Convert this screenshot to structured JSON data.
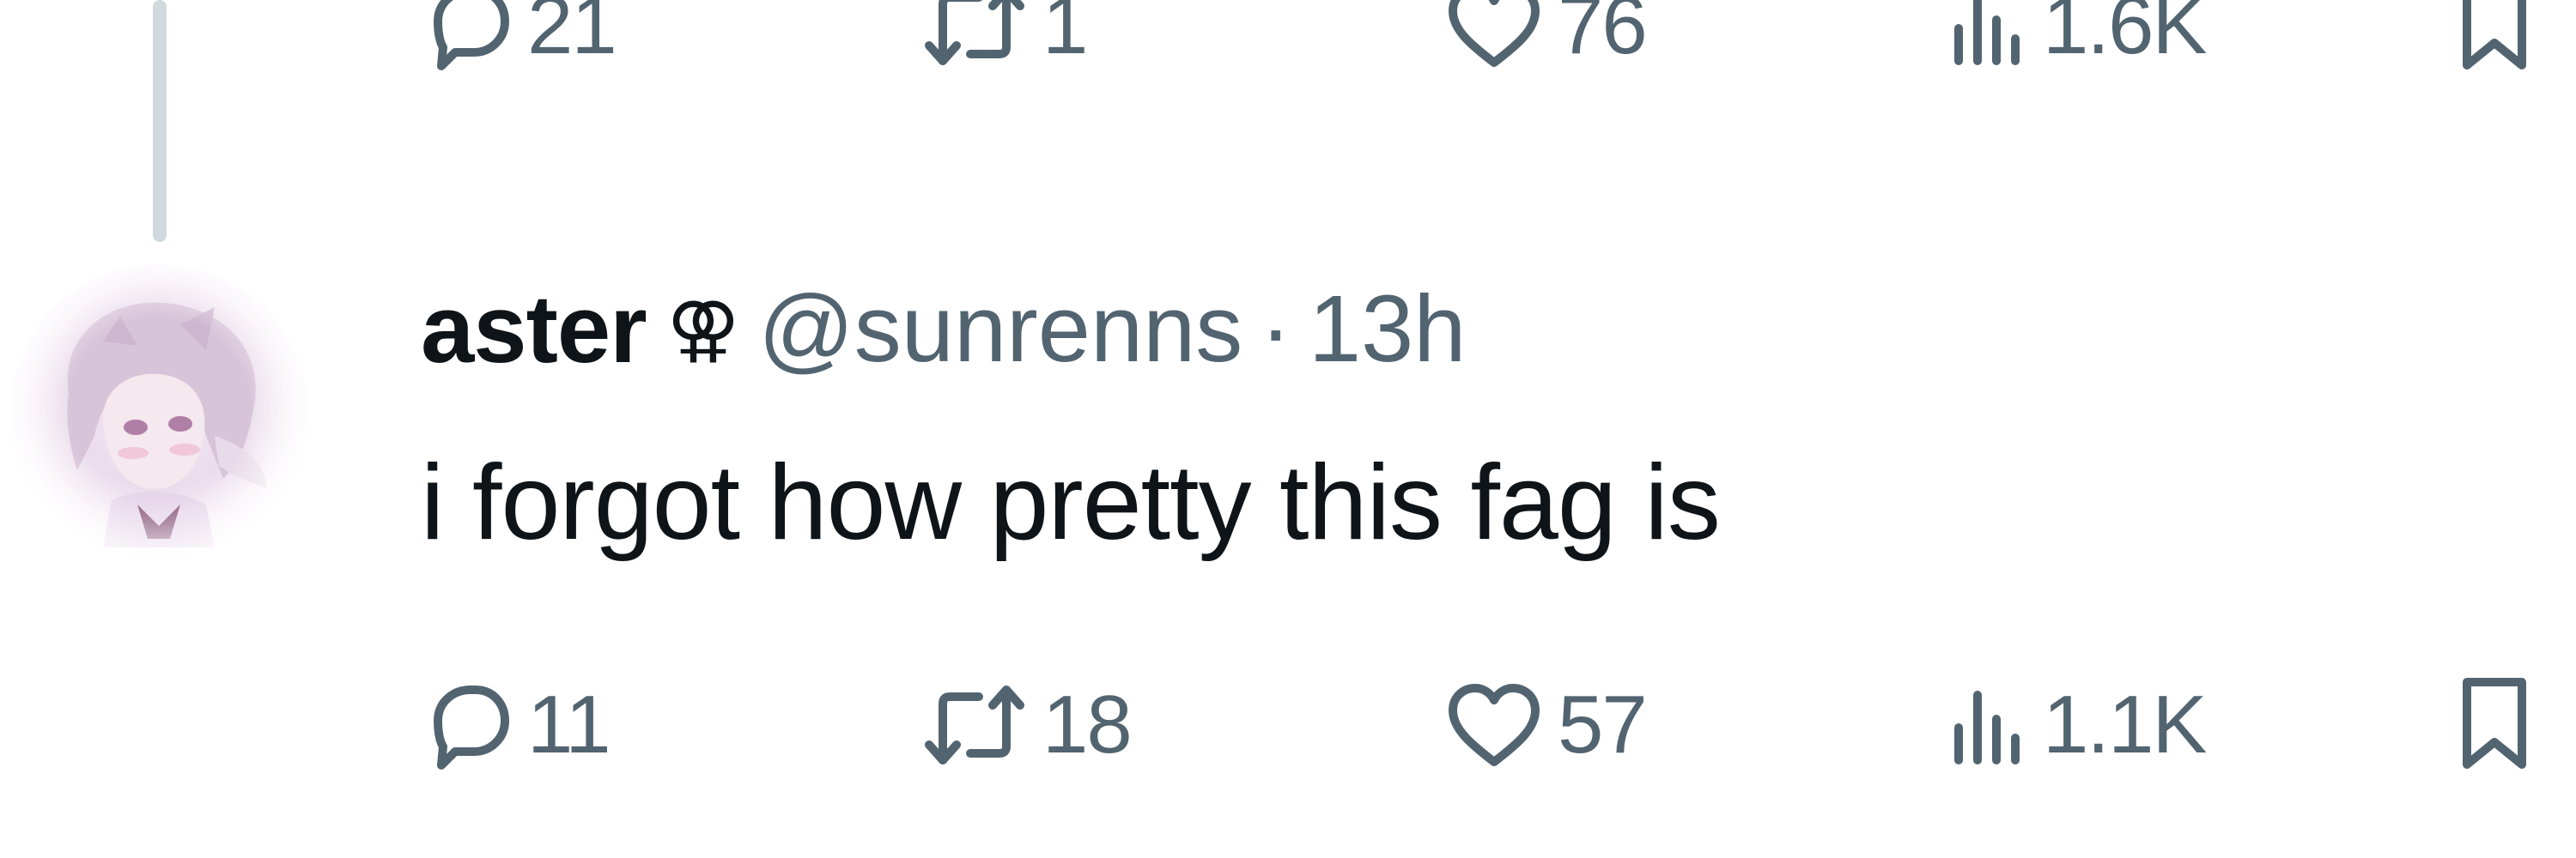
{
  "previous_tweet": {
    "actions": {
      "replies": "21",
      "retweets": "1",
      "likes": "76",
      "views": "1.6K"
    }
  },
  "tweet": {
    "author": {
      "display_name": "aster",
      "name_symbol": "⚢",
      "handle": "@sunrenns"
    },
    "separator": "·",
    "timestamp": "13h",
    "text": "i forgot how pretty this fag is",
    "actions": {
      "replies": "11",
      "retweets": "18",
      "likes": "57",
      "views": "1.1K"
    }
  },
  "icons": {
    "reply": "speech-bubble-icon",
    "retweet": "retweet-icon",
    "like": "heart-icon",
    "views": "bar-chart-icon",
    "bookmark": "bookmark-icon"
  },
  "colors": {
    "text_primary": "#0f1419",
    "text_secondary": "#536471",
    "thread_line": "#cfd9de",
    "background": "#ffffff"
  }
}
